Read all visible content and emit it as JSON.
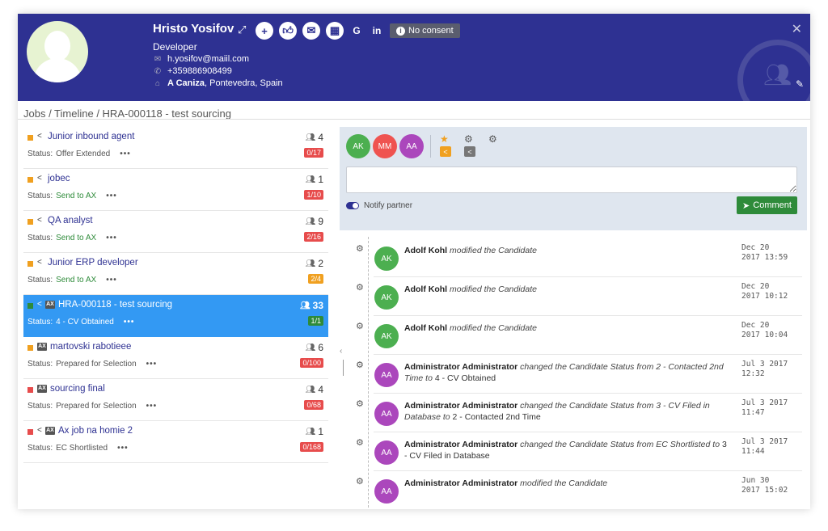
{
  "header": {
    "name": "Hristo Yosifov",
    "role": "Developer",
    "email": "h.yosifov@maiil.com",
    "phone": "+359886908499",
    "location_bold": "A Caniza",
    "location_rest": ", Pontevedra, Spain",
    "actions": [
      "plus-icon",
      "thumbs-up-icon",
      "envelope-icon",
      "calendar-icon",
      "google-icon",
      "linkedin-icon"
    ],
    "google_label": "G",
    "linkedin_label": "in",
    "consent_label": "No consent"
  },
  "breadcrumb": "Jobs / Timeline / HRA-000118 - test sourcing",
  "jobs": [
    {
      "title": "Junior inbound agent",
      "status_label": "Status:",
      "status": "Offer Extended",
      "count": "4",
      "badge": "0/17",
      "color": "#f0a020"
    },
    {
      "title": "jobec",
      "status_label": "Status:",
      "status": "Send to AX",
      "count": "1",
      "badge": "1/10",
      "color": "#f0a020"
    },
    {
      "title": "QA analyst",
      "status_label": "Status:",
      "status": "Send to AX",
      "count": "9",
      "badge": "2/16",
      "color": "#f0a020"
    },
    {
      "title": "Junior ERP developer",
      "status_label": "Status:",
      "status": "Send to AX",
      "count": "2",
      "badge": "2/4",
      "color": "#f0a020"
    },
    {
      "title": "HRA-000118 - test sourcing",
      "status_label": "Status:",
      "status": "4 - CV Obtained",
      "count": "33",
      "badge": "1/1",
      "color": "#2e8b3a"
    },
    {
      "title": "martovski rabotieee",
      "status_label": "Status:",
      "status": "Prepared for Selection",
      "count": "6",
      "badge": "0/100",
      "color": "#f0a020"
    },
    {
      "title": "sourcing final",
      "status_label": "Status:",
      "status": "Prepared for Selection",
      "count": "4",
      "badge": "0/68",
      "color": "#e74c4c"
    },
    {
      "title": "Ax job na homie 2",
      "status_label": "Status:",
      "status": "EC Shortlisted",
      "count": "1",
      "badge": "0/168",
      "color": "#e74c4c"
    }
  ],
  "ax_label": "AX",
  "dots": "•••",
  "panel": {
    "avatars": [
      "AK",
      "MM",
      "AA"
    ],
    "notify_label": "Notify partner",
    "comment_button": "Comment",
    "comment_placeholder": ""
  },
  "timeline": [
    {
      "initials": "AK",
      "actor": "Adolf Kohl",
      "action": "modified the Candidate",
      "extra": "",
      "date1": "Dec 20",
      "date2": "2017 13:59"
    },
    {
      "initials": "AK",
      "actor": "Adolf Kohl",
      "action": "modified the Candidate",
      "extra": "",
      "date1": "Dec 20",
      "date2": "2017 10:12"
    },
    {
      "initials": "AK",
      "actor": "Adolf Kohl",
      "action": "modified the Candidate",
      "extra": "",
      "date1": "Dec 20",
      "date2": "2017 10:04"
    },
    {
      "initials": "AA",
      "actor": "Administrator Administrator",
      "action": "changed the Candidate Status from 2 - Contacted 2nd Time to",
      "extra": "4 - CV Obtained",
      "date1": "Jul 3 2017",
      "date2": "12:32"
    },
    {
      "initials": "AA",
      "actor": "Administrator Administrator",
      "action": "changed the Candidate Status from 3 - CV Filed in Database to",
      "extra": "2 - Contacted 2nd Time",
      "date1": "Jul 3 2017",
      "date2": "11:47"
    },
    {
      "initials": "AA",
      "actor": "Administrator Administrator",
      "action": "changed the Candidate Status from EC Shortlisted to",
      "extra": "3 - CV Filed in Database",
      "date1": "Jul 3 2017",
      "date2": "11:44"
    },
    {
      "initials": "AA",
      "actor": "Administrator Administrator",
      "action": "modified the Candidate",
      "extra": "",
      "date1": "Jun 30",
      "date2": "2017 15:02"
    }
  ]
}
